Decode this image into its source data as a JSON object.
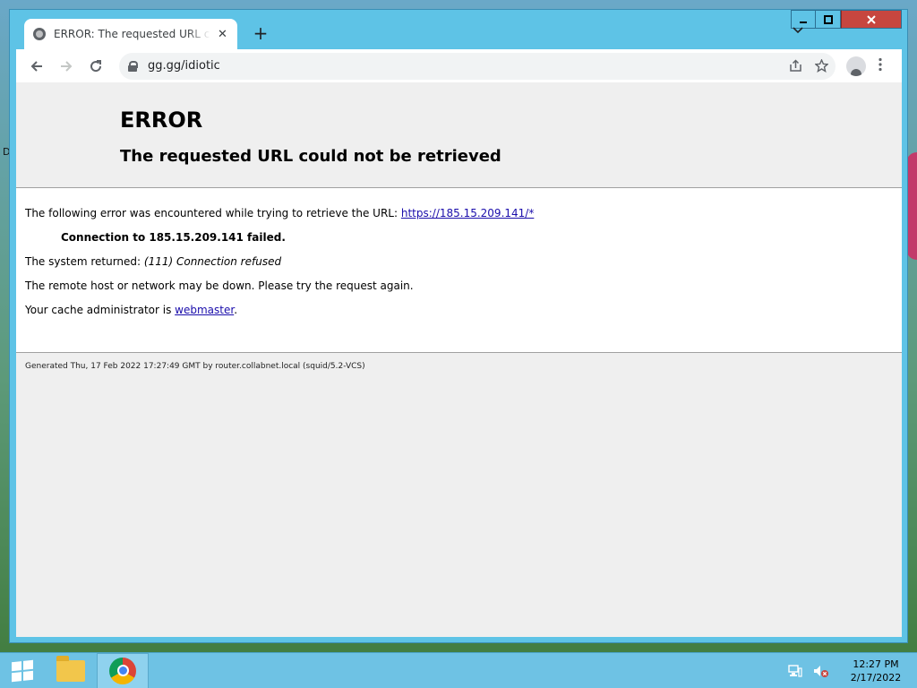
{
  "browser": {
    "tab_title": "ERROR: The requested URL could not be retrieved",
    "tab_close": "✕",
    "new_tab": "+",
    "url": "gg.gg/idiotic"
  },
  "page": {
    "title": "ERROR",
    "subtitle": "The requested URL could not be retrieved",
    "error_line_prefix": "The following error was encountered while trying to retrieve the URL: ",
    "error_url": "https://185.15.209.141/*",
    "connection_failed": "Connection to 185.15.209.141 failed.",
    "system_returned_prefix": "The system returned: ",
    "system_returned_value": "(111) Connection refused",
    "remote_host_msg": "The remote host or network may be down. Please try the request again.",
    "cache_admin_prefix": "Your cache administrator is ",
    "cache_admin_link": "webmaster",
    "cache_admin_suffix": ".",
    "footer": "Generated Thu, 17 Feb 2022 17:27:49 GMT by router.collabnet.local (squid/5.2-VCS)"
  },
  "desktop": {
    "edge_letter": "D"
  },
  "taskbar": {
    "time": "12:27 PM",
    "date": "2/17/2022"
  }
}
